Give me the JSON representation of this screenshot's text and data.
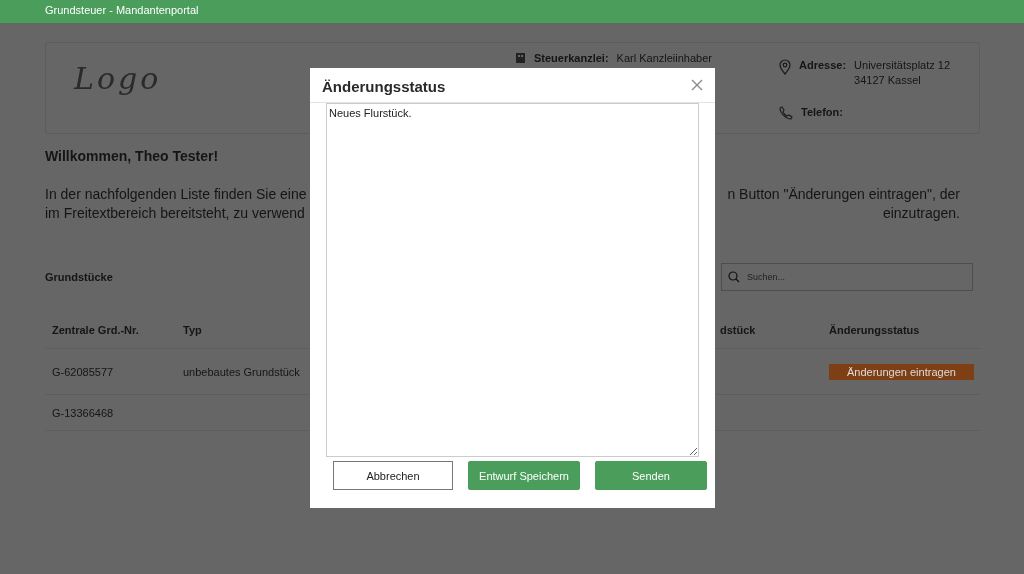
{
  "app_bar": {
    "title": "Grundsteuer - Mandantenportal"
  },
  "office_card": {
    "logo": "Logo",
    "items": [
      {
        "kind": "office",
        "label": "Steuerkanzlei:",
        "value_lines": [
          "Karl Kanzleiinhaber"
        ]
      },
      {
        "kind": "address",
        "label": "Adresse:",
        "value_lines": [
          "Universitätsplatz 12",
          "34127 Kassel"
        ]
      },
      {
        "kind": "phone",
        "label": "Telefon:"
      }
    ]
  },
  "welcome": "Willkommen, Theo Tester!",
  "intro_lines": [
    {
      "left": "In der nachfolgenden Liste finden Sie eine",
      "right": "n Button \"Änderungen eintragen\", der"
    },
    {
      "left": "im Freitextbereich bereitsteht, zu verwend",
      "right": "einzutragen."
    }
  ],
  "properties": {
    "title": "Grundstücke",
    "search": {
      "placeholder": "Suchen..."
    },
    "columns": [
      "Zentrale Grd.-Nr.",
      "Typ",
      "dstück",
      "Änderungsstatus"
    ],
    "rows": [
      {
        "grd_nr": "G-62085577",
        "type": "unbebautes Grundstück",
        "action": "Änderungen eintragen"
      },
      {
        "grd_nr": "G-13366468"
      }
    ]
  },
  "dialog": {
    "title": "Änderungsstatus",
    "text": "Neues Flurstück.",
    "buttons": [
      {
        "label": "Abbrechen",
        "kind": "secondary"
      },
      {
        "label": "Entwurf Speichern",
        "kind": "primary"
      },
      {
        "label": "Senden",
        "kind": "primary"
      }
    ]
  }
}
